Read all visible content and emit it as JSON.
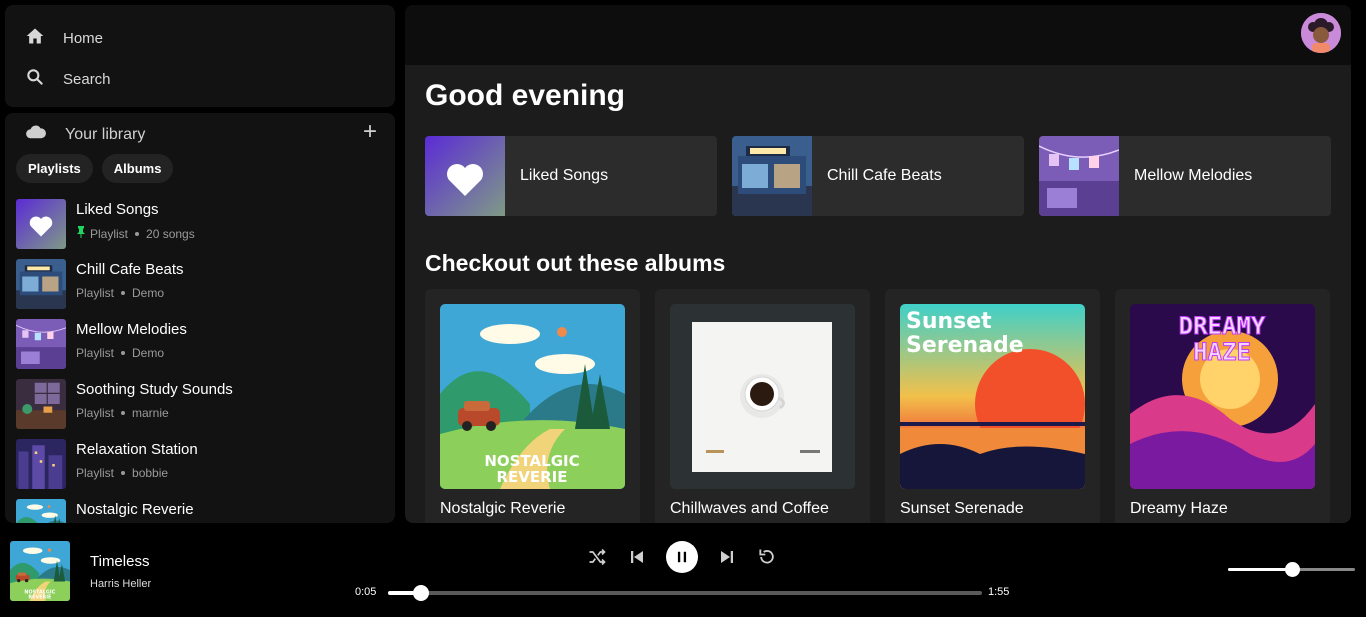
{
  "nav": {
    "home_label": "Home",
    "search_label": "Search"
  },
  "library": {
    "title": "Your library",
    "add_symbol": "+",
    "chips": [
      "Playlists",
      "Albums"
    ],
    "items": [
      {
        "title": "Liked Songs",
        "type": "Playlist",
        "detail": "20 songs",
        "pinned": true,
        "art": "liked"
      },
      {
        "title": "Chill Cafe Beats",
        "type": "Playlist",
        "detail": "Demo",
        "pinned": false,
        "art": "cafe"
      },
      {
        "title": "Mellow Melodies",
        "type": "Playlist",
        "detail": "Demo",
        "pinned": false,
        "art": "mellow"
      },
      {
        "title": "Soothing Study Sounds",
        "type": "Playlist",
        "detail": "marnie",
        "pinned": false,
        "art": "study"
      },
      {
        "title": "Relaxation Station",
        "type": "Playlist",
        "detail": "bobbie",
        "pinned": false,
        "art": "relax"
      },
      {
        "title": "Nostalgic Reverie",
        "type": "",
        "detail": "",
        "pinned": false,
        "art": "nostalgic"
      }
    ]
  },
  "main": {
    "greeting": "Good evening",
    "quick": [
      {
        "label": "Liked Songs",
        "art": "liked"
      },
      {
        "label": "Chill Cafe Beats",
        "art": "cafe"
      },
      {
        "label": "Mellow Melodies",
        "art": "mellow"
      }
    ],
    "section_title": "Checkout out these albums",
    "albums": [
      {
        "title": "Nostalgic Reverie",
        "art": "nostalgic",
        "cover_text": "NOSTALGIC REVERIE"
      },
      {
        "title": "Chillwaves and Coffee",
        "art": "coffee",
        "cover_text": ""
      },
      {
        "title": "Sunset Serenade",
        "art": "sunset",
        "cover_text": "Sunset Serenade"
      },
      {
        "title": "Dreamy Haze",
        "art": "dreamy",
        "cover_text": "DREAMY HAZE"
      }
    ]
  },
  "player": {
    "title": "Timeless",
    "artist": "Harris Heller",
    "elapsed": "0:05",
    "duration": "1:55",
    "progress_fraction": 0.055,
    "volume_fraction": 0.5,
    "is_playing": true
  },
  "colors": {
    "accent_green": "#1ed760",
    "liked_gradient_start": "#5b2bd6",
    "liked_gradient_end": "#7f9a86"
  }
}
